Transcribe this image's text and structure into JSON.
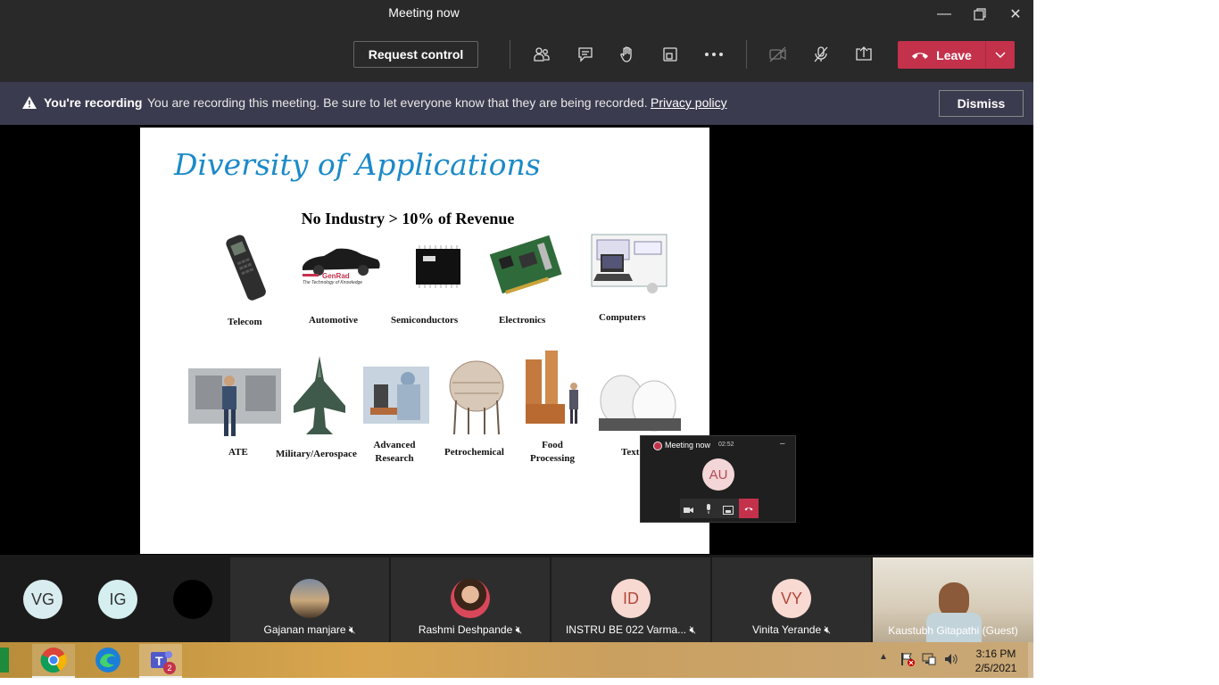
{
  "window": {
    "title": "Meeting now"
  },
  "toolbar": {
    "request_control": "Request control",
    "leave": "Leave"
  },
  "recording_banner": {
    "title": "You're recording",
    "message": "You are recording this meeting. Be sure to let everyone know that they are being recorded.",
    "link": "Privacy policy",
    "dismiss": "Dismiss"
  },
  "slide": {
    "title": "Diversity of Applications",
    "subtitle": "No Industry > 10% of Revenue",
    "row1": [
      "Telecom",
      "Automotive",
      "Semiconductors",
      "Electronics",
      "Computers"
    ],
    "row2": [
      "ATE",
      "Military/Aerospace",
      "Advanced Research",
      "Petrochemical",
      "Food Processing",
      "Text"
    ],
    "genrad_brand": "GenRad",
    "genrad_tagline": "The Technology of Knowledge"
  },
  "mini_window": {
    "title": "Meeting now",
    "timer": "02:52",
    "minimize": "–",
    "avatar": "AU"
  },
  "participants": {
    "left_avatars": [
      "VG",
      "IG",
      ""
    ],
    "tiles": [
      {
        "name": "Gajanan manjare"
      },
      {
        "name": "Rashmi Deshpande"
      },
      {
        "name": "INSTRU BE 022 Varma...",
        "initials": "ID"
      },
      {
        "name": "Vinita Yerande",
        "initials": "VY"
      },
      {
        "name": "Kaustubh Gitapathi (Guest)"
      }
    ]
  },
  "taskbar": {
    "time": "3:16 PM",
    "date": "2/5/2021",
    "teams_badge": "2"
  },
  "colors": {
    "leave": "#c4314b",
    "banner": "#3b3b4f",
    "title_blue": "#1b8ac8"
  }
}
